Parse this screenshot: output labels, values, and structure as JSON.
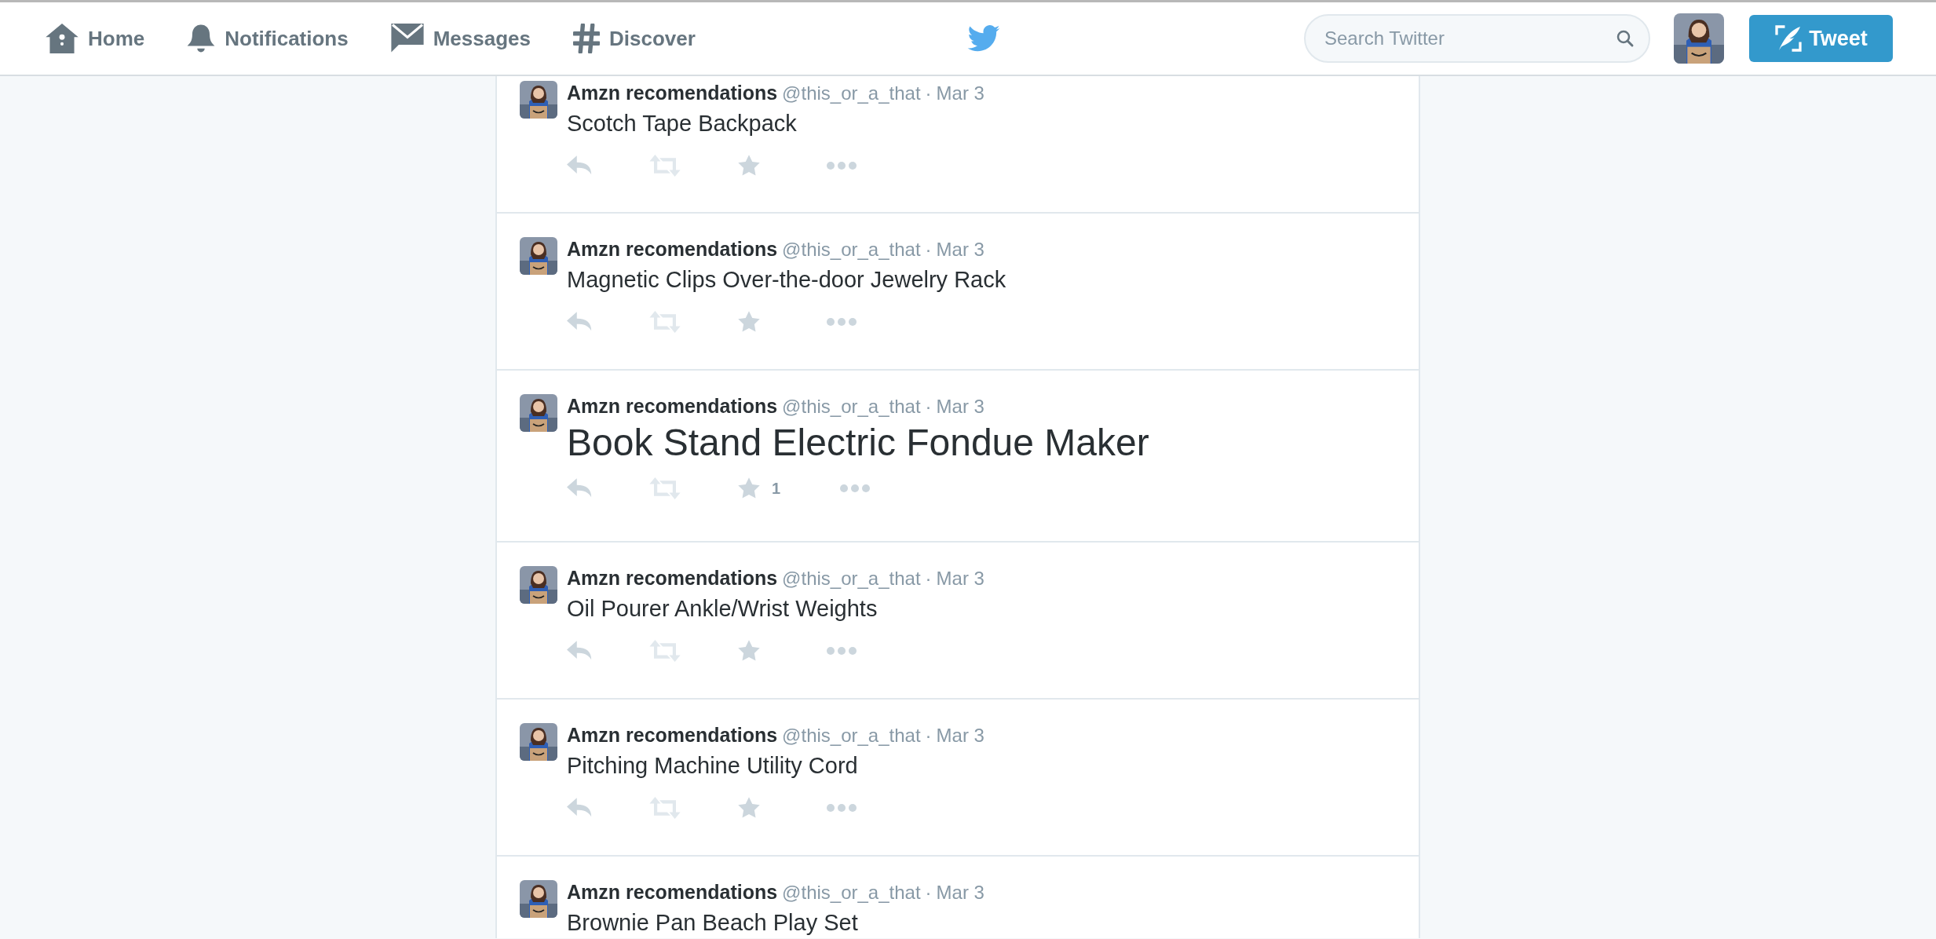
{
  "nav": {
    "items": [
      {
        "label": "Home"
      },
      {
        "label": "Notifications"
      },
      {
        "label": "Messages"
      },
      {
        "label": "Discover"
      }
    ]
  },
  "search": {
    "placeholder": "Search Twitter"
  },
  "tweet_button": {
    "label": "Tweet"
  },
  "timeline": [
    {
      "name": "Amzn recomendations",
      "handle": "@this_or_a_that",
      "separator": "·",
      "date": "Mar 3",
      "text": "Scotch Tape Backpack",
      "large": false
    },
    {
      "name": "Amzn recomendations",
      "handle": "@this_or_a_that",
      "separator": "·",
      "date": "Mar 3",
      "text": "Magnetic Clips Over-the-door Jewelry Rack",
      "large": false
    },
    {
      "name": "Amzn recomendations",
      "handle": "@this_or_a_that",
      "separator": "·",
      "date": "Mar 3",
      "text": "Book Stand Electric Fondue Maker",
      "large": true,
      "favorites": "1"
    },
    {
      "name": "Amzn recomendations",
      "handle": "@this_or_a_that",
      "separator": "·",
      "date": "Mar 3",
      "text": "Oil Pourer Ankle/Wrist Weights",
      "large": false
    },
    {
      "name": "Amzn recomendations",
      "handle": "@this_or_a_that",
      "separator": "·",
      "date": "Mar 3",
      "text": "Pitching Machine Utility Cord",
      "large": false
    },
    {
      "name": "Amzn recomendations",
      "handle": "@this_or_a_that",
      "separator": "·",
      "date": "Mar 3",
      "text": "Brownie Pan Beach Play Set",
      "large": false
    }
  ]
}
